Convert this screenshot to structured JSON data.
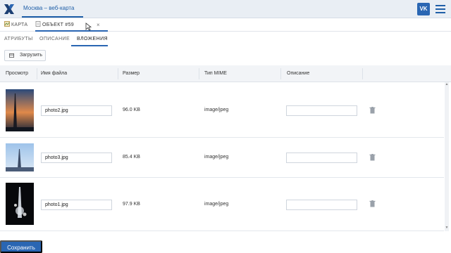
{
  "header": {
    "app_title": "Москва – веб-карта",
    "user_badge": "VK",
    "logo_icon": "x-logo-icon",
    "menu_icon": "hamburger-icon",
    "accent_color": "#2a66b3"
  },
  "tabs": [
    {
      "label": "КАРТА",
      "icon": "map-icon"
    },
    {
      "label": "ОБЪЕКТ #59",
      "icon": "document-icon",
      "active": true,
      "close": "×"
    }
  ],
  "subtabs": [
    {
      "label": "АТРИБУТЫ"
    },
    {
      "label": "ОПИСАНИЕ"
    },
    {
      "label": "ВЛОЖЕНИЯ",
      "active": true
    }
  ],
  "upload_button": "Загрузить",
  "table": {
    "columns": [
      "Просмотр",
      "Имя файла",
      "Размер",
      "Тип MIME",
      "Описание"
    ],
    "rows": [
      {
        "file_name": "photo2.jpg",
        "size": "96.0 KB",
        "mime": "image/jpeg",
        "description": ""
      },
      {
        "file_name": "photo3.jpg",
        "size": "85.4 KB",
        "mime": "image/jpeg",
        "description": ""
      },
      {
        "file_name": "photo1.jpg",
        "size": "97.9 KB",
        "mime": "image/jpeg",
        "description": ""
      }
    ]
  },
  "save_button": "Сохранить"
}
